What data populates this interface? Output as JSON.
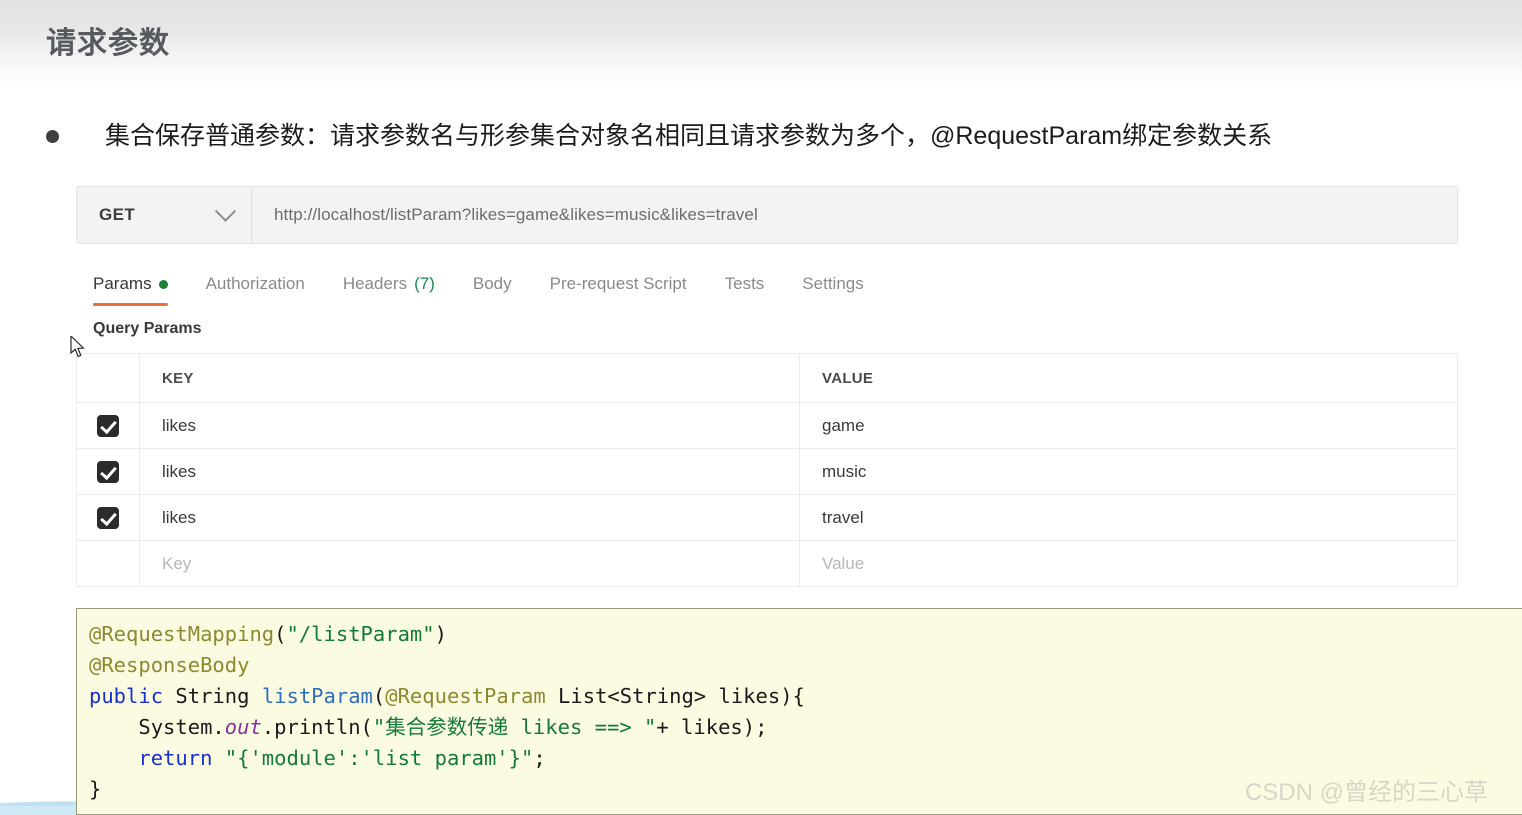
{
  "header": {
    "title": "请求参数"
  },
  "bullet": {
    "text": "集合保存普通参数：请求参数名与形参集合对象名相同且请求参数为多个，@RequestParam绑定参数关系"
  },
  "postman": {
    "method": "GET",
    "method_chevron_icon": "chevron-down-icon",
    "url": "http://localhost/listParam?likes=game&likes=music&likes=travel",
    "tabs": [
      {
        "label": "Params",
        "active": true,
        "dot": true
      },
      {
        "label": "Authorization",
        "active": false
      },
      {
        "label": "Headers",
        "count": "(7)",
        "active": false
      },
      {
        "label": "Body",
        "active": false
      },
      {
        "label": "Pre-request Script",
        "active": false
      },
      {
        "label": "Tests",
        "active": false
      },
      {
        "label": "Settings",
        "active": false
      }
    ],
    "section_label": "Query Params",
    "table": {
      "columns": [
        "KEY",
        "VALUE"
      ],
      "rows": [
        {
          "checked": true,
          "key": "likes",
          "value": "game"
        },
        {
          "checked": true,
          "key": "likes",
          "value": "music"
        },
        {
          "checked": true,
          "key": "likes",
          "value": "travel"
        }
      ],
      "placeholder_row": {
        "key": "Key",
        "value": "Value"
      }
    }
  },
  "code": {
    "lines": [
      "@RequestMapping(\"/listParam\")",
      "@ResponseBody",
      "public String listParam(@RequestParam List<String> likes){",
      "    System.out.println(\"集合参数传递 likes ==> \"+ likes);",
      "    return \"{'module':'list param'}\";",
      "}"
    ]
  },
  "watermark": {
    "text": "CSDN @曾经的三心草"
  },
  "colors": {
    "accent_underline": "#e8703a",
    "status_dot": "#1a7f37",
    "code_bg": "#fbfbe2",
    "annotation": "#8a8a30",
    "string": "#137a37",
    "keyword": "#1a31d0",
    "wave": "#c6e6f3"
  }
}
